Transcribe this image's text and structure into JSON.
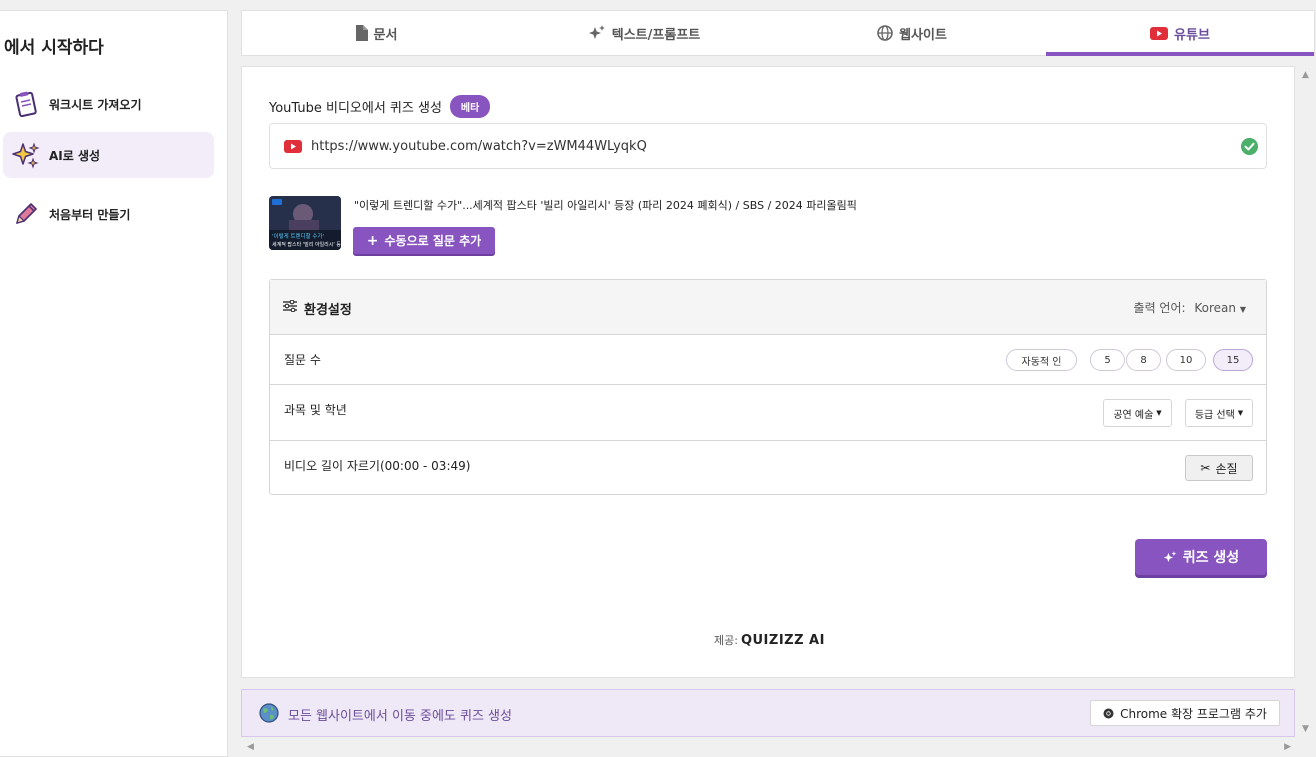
{
  "sidebar": {
    "heading": "에서 시작하다",
    "items": [
      {
        "label": "워크시트 가져오기",
        "icon": "clipboard-icon"
      },
      {
        "label": "AI로 생성",
        "icon": "sparkles-icon",
        "active": true
      },
      {
        "label": "처음부터 만들기",
        "icon": "pencil-icon"
      }
    ]
  },
  "tabs": [
    {
      "label": "문서",
      "icon": "document-icon"
    },
    {
      "label": "텍스트/프롬프트",
      "icon": "sparkle-icon"
    },
    {
      "label": "웹사이트",
      "icon": "globe-icon"
    },
    {
      "label": "유튜브",
      "icon": "youtube-icon",
      "active": true
    }
  ],
  "main": {
    "title": "YouTube 비디오에서 퀴즈 생성",
    "badge": "베타",
    "url": "https://www.youtube.com/watch?v=zWM44WLyqkQ",
    "video_title": "\"이렇게 트렌디할 수가\"...세계적 팝스타 '빌리 아일리시' 등장 (파리 2024 폐회식) / SBS / 2024 파리올림픽",
    "thumb_text": "'이렇게 트렌디할 수가' 세계적 팝스타 '빌리 아일리시' 등장",
    "add_manual_label": "수동으로 질문 추가",
    "settings": {
      "title": "환경설정",
      "output_language_label": "출력 언어:",
      "output_language_value": "Korean",
      "question_count_label": "질문 수",
      "question_count_options": [
        "자동적 인",
        "5",
        "8",
        "10",
        "15"
      ],
      "question_count_selected": "15",
      "subject_grade_label": "과목 및 학년",
      "subject_value": "공연 예술",
      "grade_value": "등급 선택",
      "trim_label": "비디오 길이 자르기(00:00 - 03:49)",
      "trim_button": "손질"
    },
    "generate_label": "퀴즈 생성",
    "powered_by_label": "제공:",
    "powered_by_brand": "QUIZIZZ AI"
  },
  "banner": {
    "text": "모든 웹사이트에서 이동 중에도 퀴즈 생성",
    "cta": "Chrome 확장 프로그램 추가"
  },
  "colors": {
    "accent": "#8854c0",
    "accent_light": "#f2edf9",
    "youtube_red": "#e02f3a",
    "success": "#4caf6a"
  }
}
